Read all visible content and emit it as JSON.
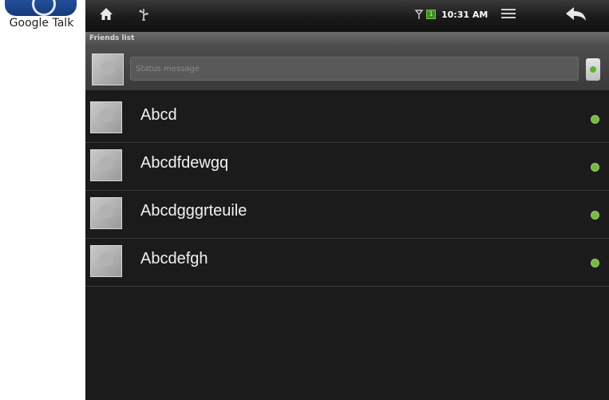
{
  "desktop": {
    "app_label": "Google Talk",
    "app_icon": "google-talk-icon"
  },
  "statusbar": {
    "time": "10:31 AM",
    "battery_text": "1",
    "icons": [
      "home-icon",
      "usb-icon",
      "signal-icon",
      "battery-icon",
      "menu-icon",
      "back-arrow-icon"
    ]
  },
  "title": "Friends list",
  "status": {
    "placeholder": "Status message",
    "presence_color": "#5cb338"
  },
  "friends": [
    {
      "name": "Abcd",
      "online": true
    },
    {
      "name": "Abcdfdewgq",
      "online": true
    },
    {
      "name": "Abcdgggrteuile",
      "online": true
    },
    {
      "name": "Abcdefgh",
      "online": true
    }
  ],
  "colors": {
    "online": "#7ab648",
    "screen_bg": "#1b1b1b"
  }
}
